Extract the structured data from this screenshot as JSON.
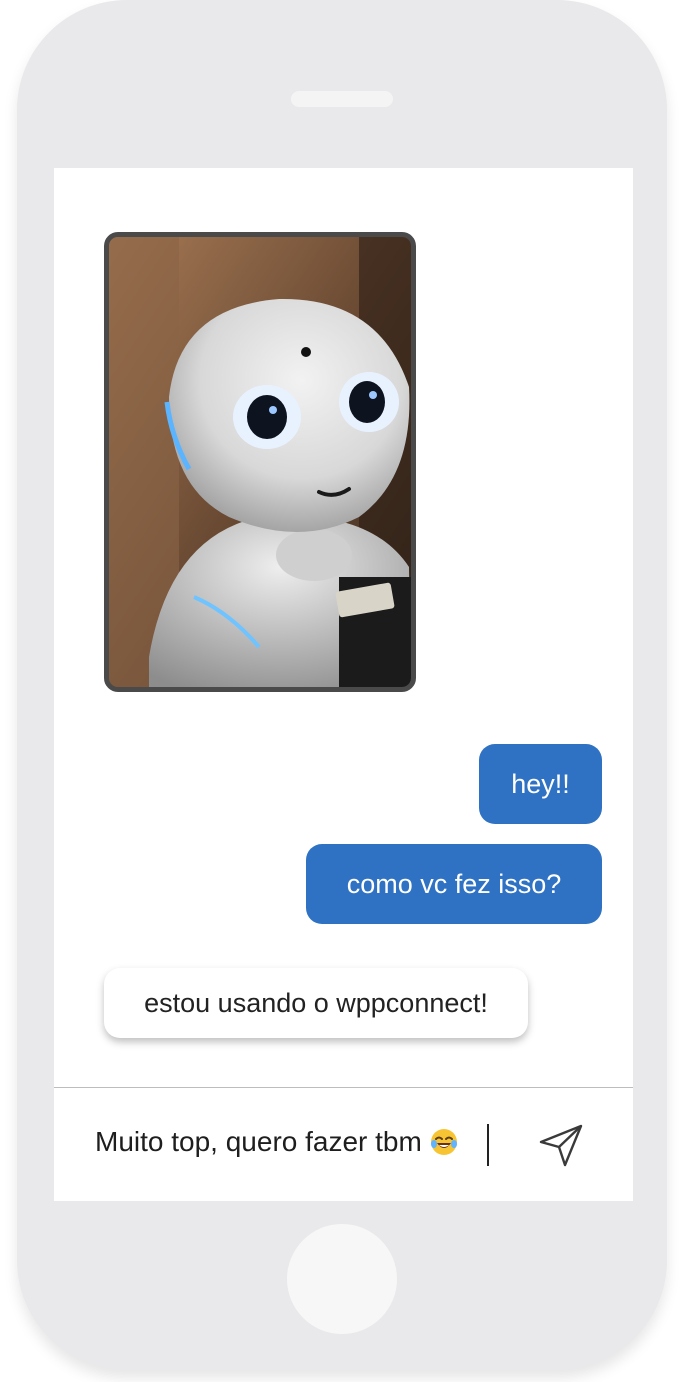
{
  "chat": {
    "image_message": {
      "icon": "robot-photo"
    },
    "messages": [
      {
        "direction": "outgoing",
        "text": "hey!!"
      },
      {
        "direction": "outgoing",
        "text": "como vc fez isso?"
      },
      {
        "direction": "incoming",
        "text": "estou usando o wppconnect!"
      }
    ]
  },
  "composer": {
    "value": "Muito top, quero fazer tbm",
    "emoji": "face-with-tears-of-joy-icon",
    "send_icon": "send-icon"
  },
  "colors": {
    "outgoing_bubble": "#2f72c3",
    "incoming_bubble": "#ffffff",
    "phone_frame": "#e9e9eb"
  }
}
